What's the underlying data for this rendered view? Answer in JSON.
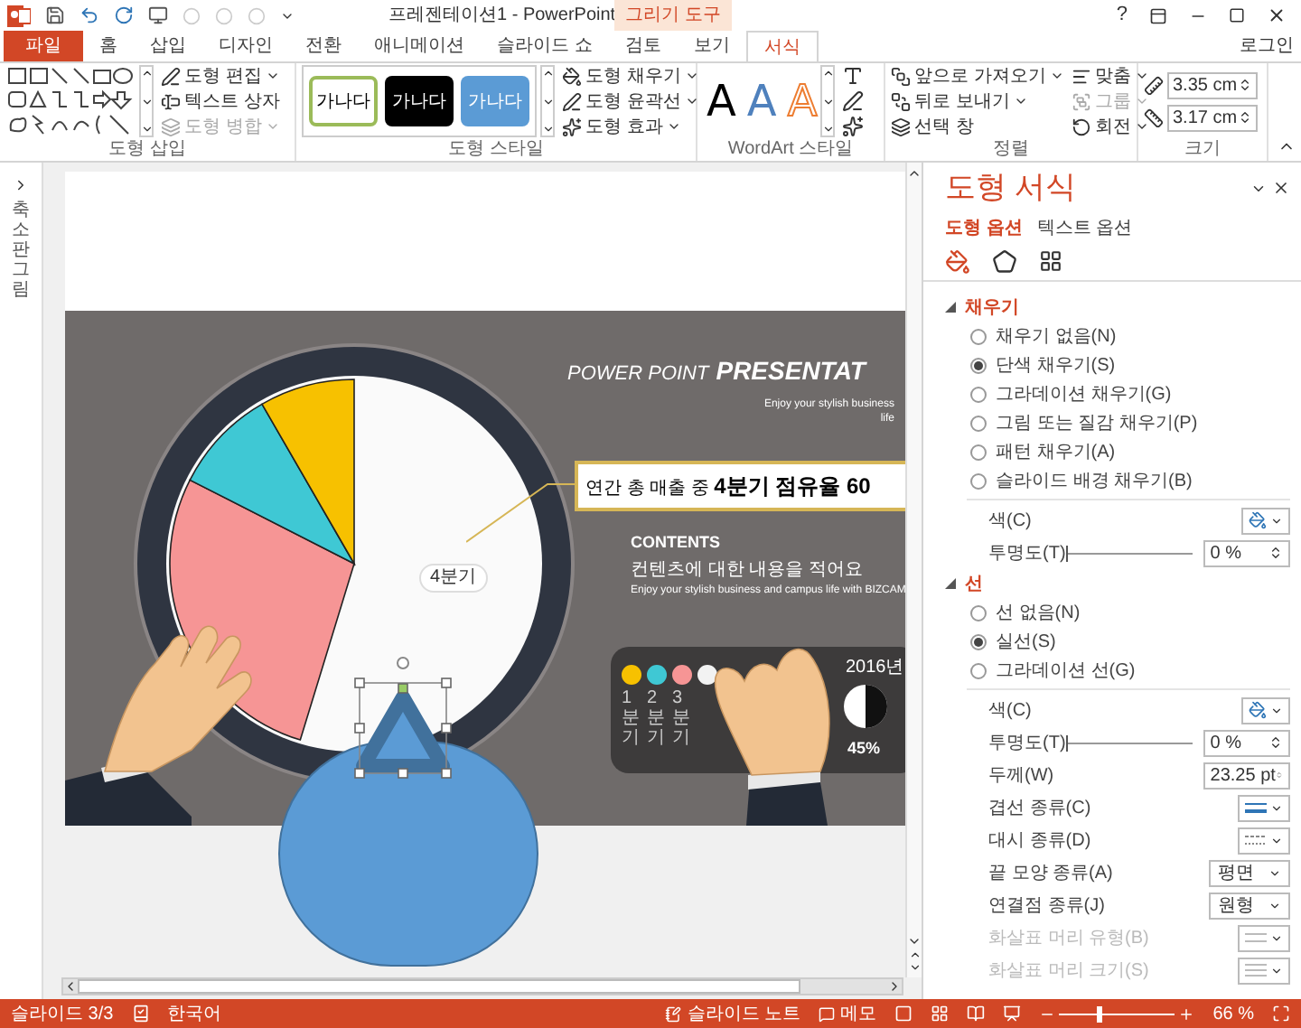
{
  "title_bar": {
    "title": "프레젠테이션1 - PowerPoint",
    "context_label": "그리기 도구",
    "help": "?"
  },
  "tabs": [
    {
      "label": "파일",
      "kind": "file",
      "selected": false
    },
    {
      "label": "홈",
      "kind": "normal",
      "selected": false
    },
    {
      "label": "삽입",
      "kind": "normal",
      "selected": false
    },
    {
      "label": "디자인",
      "kind": "normal",
      "selected": false
    },
    {
      "label": "전환",
      "kind": "normal",
      "selected": false
    },
    {
      "label": "애니메이션",
      "kind": "normal",
      "selected": false
    },
    {
      "label": "슬라이드 쇼",
      "kind": "normal",
      "selected": false
    },
    {
      "label": "검토",
      "kind": "normal",
      "selected": false
    },
    {
      "label": "보기",
      "kind": "normal",
      "selected": false
    },
    {
      "label": "서식",
      "kind": "normal",
      "selected": true
    }
  ],
  "account": "로그인",
  "ribbon": {
    "insert_shapes": {
      "commands": [
        {
          "label": "도형 편집",
          "disabled": false
        },
        {
          "label": "텍스트 상자",
          "disabled": false
        },
        {
          "label": "도형 병합",
          "disabled": true
        }
      ],
      "group_label": "도형 삽입"
    },
    "shape_styles": {
      "presets": [
        {
          "label": "가나다"
        },
        {
          "label": "가나다"
        },
        {
          "label": "가나다"
        }
      ],
      "commands": [
        "도형 채우기",
        "도형 윤곽선",
        "도형 효과"
      ],
      "group_label": "도형 스타일"
    },
    "wordart": {
      "samples": [
        {
          "label": "A"
        },
        {
          "label": "A"
        },
        {
          "label": "A"
        }
      ],
      "group_label": "WordArt 스타일"
    },
    "arrange": {
      "commands": [
        {
          "label": "앞으로 가져오기",
          "disabled": false
        },
        {
          "label": "뒤로 보내기",
          "disabled": false
        },
        {
          "label": "선택 창",
          "disabled": false
        },
        {
          "label": "맞춤",
          "disabled": false
        },
        {
          "label": "그룹",
          "disabled": true
        },
        {
          "label": "회전",
          "disabled": false
        }
      ],
      "group_label": "정렬"
    },
    "size": {
      "height": "3.35 cm",
      "width": "3.17 cm",
      "group_label": "크기"
    }
  },
  "thumbnails_label": "축소판 그림",
  "slide": {
    "title_light": "POWER POINT",
    "title_bold": "PRESENTAT",
    "subtitle": [
      "Enjoy your stylish business",
      "life"
    ],
    "callout": "연간 총 매출 중 **4분기 점유율 60**",
    "pie_label": "4분기",
    "contents_heading": "CONTENTS",
    "contents_title": "컨텐츠에 대한 내용을 적어요",
    "contents_body": "Enjoy your stylish business and campus life with BIZCAM",
    "legend": [
      {
        "color": "#f7c100",
        "label": "1분기"
      },
      {
        "color": "#3fc8d4",
        "label": "2분기"
      },
      {
        "color": "#f69595",
        "label": "3분기"
      },
      {
        "color": "#f2f2f2"
      }
    ],
    "year": "2016년",
    "percent": "45%"
  },
  "format_pane": {
    "title": "도형 서식",
    "tabs": [
      {
        "label": "도형 옵션",
        "selected": true
      },
      {
        "label": "텍스트 옵션",
        "selected": false
      }
    ],
    "sections": [
      {
        "title": "채우기",
        "expanded": true,
        "options": [
          {
            "label": "채우기 없음(N)",
            "selected": false
          },
          {
            "label": "단색 채우기(S)",
            "selected": true
          },
          {
            "label": "그라데이션 채우기(G)",
            "selected": false
          },
          {
            "label": "그림 또는 질감 채우기(P)",
            "selected": false
          },
          {
            "label": "패턴 채우기(A)",
            "selected": false
          },
          {
            "label": "슬라이드 배경 채우기(B)",
            "selected": false
          }
        ],
        "rows": [
          {
            "kind": "color",
            "label": "색(C)",
            "disabled": false
          },
          {
            "kind": "slider",
            "label": "투명도(T)",
            "value": "0 %",
            "level": 0,
            "disabled": false
          }
        ]
      },
      {
        "title": "선",
        "expanded": true,
        "options": [
          {
            "label": "선 없음(N)",
            "selected": false
          },
          {
            "label": "실선(S)",
            "selected": true
          },
          {
            "label": "그라데이션 선(G)",
            "selected": false
          }
        ],
        "rows": [
          {
            "kind": "color",
            "label": "색(C)",
            "disabled": false
          },
          {
            "kind": "slider",
            "label": "투명도(T)",
            "value": "0 %",
            "level": 0,
            "disabled": false
          },
          {
            "kind": "spin",
            "label": "두께(W)",
            "value": "23.25 pt",
            "disabled": false
          },
          {
            "kind": "line_style",
            "label": "겹선 종류(C)",
            "disabled": false
          },
          {
            "kind": "dash_style",
            "label": "대시 종류(D)",
            "disabled": false
          },
          {
            "kind": "select",
            "label": "끝 모양 종류(A)",
            "value": "평면",
            "disabled": false
          },
          {
            "kind": "select",
            "label": "연결점 종류(J)",
            "value": "원형",
            "disabled": false
          },
          {
            "kind": "arrow_style",
            "label": "화살표 머리 유형(B)",
            "disabled": true
          },
          {
            "kind": "arrow_size",
            "label": "화살표 머리 크기(S)",
            "disabled": true
          }
        ]
      }
    ]
  },
  "status_bar": {
    "slide_counter": "슬라이드 3/3",
    "language": "한국어",
    "notes": "슬라이드 노트",
    "comments": "메모",
    "zoom_slider": {
      "level": 0.32
    },
    "zoom": "66 %"
  }
}
